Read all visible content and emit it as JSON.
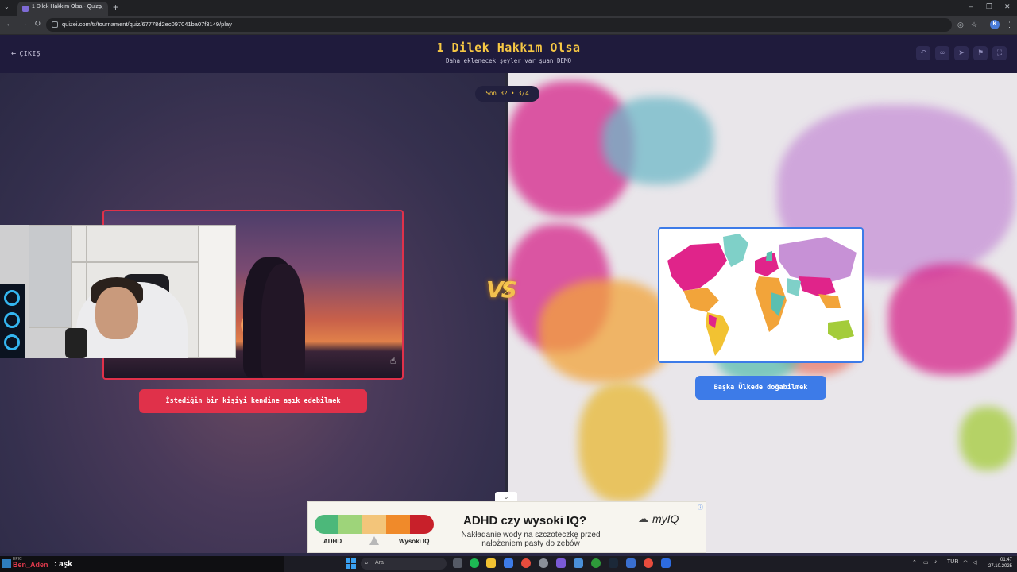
{
  "browser": {
    "tab_title": "1 Dilek Hakkım Olsa - Quizei",
    "url": "quizei.com/tr/tournament/quiz/67778d2ec097041ba07f3149/play",
    "profile_initial": "K"
  },
  "header": {
    "exit_label": "ÇIKIŞ",
    "title": "1 Dilek Hakkım Olsa",
    "subtitle": "Daha eklenecek şeyler var şuan DEMO"
  },
  "round": {
    "label": "Son 32 • 3/4"
  },
  "left_choice": {
    "label": "İstediğin bir kişiyi kendine aşık edebilmek",
    "accent": "#e0314a"
  },
  "right_choice": {
    "label": "Başka Ülkede doğabilmek",
    "accent": "#3d7be8"
  },
  "vs_label": "VS",
  "ad": {
    "headline": "ADHD czy wysoki IQ?",
    "body_line1": "Nakładanie wody na szczoteczkę przed",
    "body_line2": "nałożeniem pasty do zębów",
    "scale_left": "ADHD",
    "scale_right": "Wysoki IQ",
    "brand": "myIQ",
    "colors": [
      "#4cb87a",
      "#9ed47a",
      "#f3c57a",
      "#f08a2a",
      "#c8202a"
    ]
  },
  "chat": {
    "username": "Ben_Aden",
    "message": ": aşk",
    "badge": "EPIC"
  },
  "taskbar": {
    "search_placeholder": "Ara",
    "lang": "TUR",
    "time": "01:47",
    "date": "27.10.2025"
  }
}
